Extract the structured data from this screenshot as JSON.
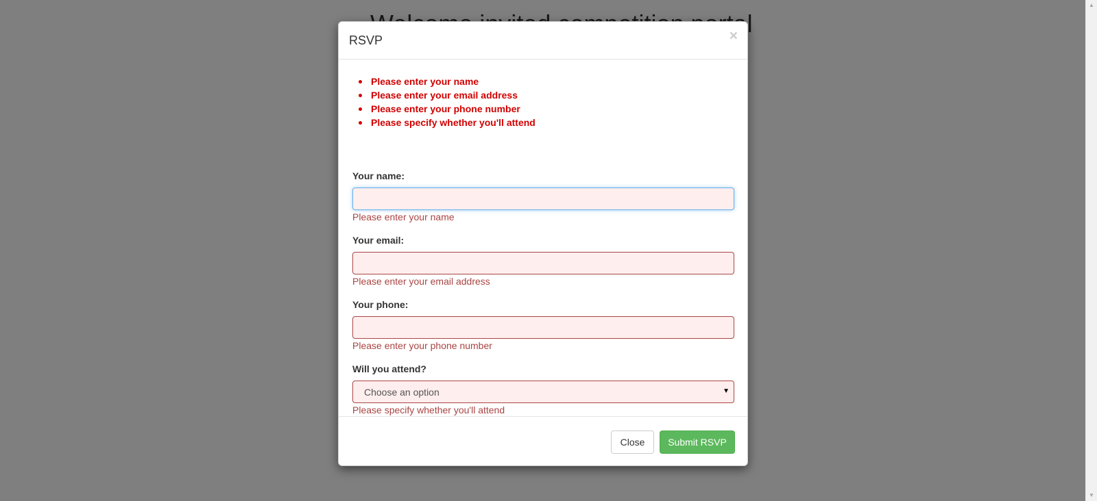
{
  "page": {
    "heading": "Welcome invited competition portal"
  },
  "modal": {
    "title": "RSVP",
    "close_symbol": "×",
    "validation_summary": [
      "Please enter your name",
      "Please enter your email address",
      "Please enter your phone number",
      "Please specify whether you'll attend"
    ],
    "fields": {
      "name": {
        "label": "Your name:",
        "value": "",
        "error": "Please enter your name"
      },
      "email": {
        "label": "Your email:",
        "value": "",
        "error": "Please enter your email address"
      },
      "phone": {
        "label": "Your phone:",
        "value": "",
        "error": "Please enter your phone number"
      },
      "attend": {
        "label": "Will you attend?",
        "selected": "Choose an option",
        "error": "Please specify whether you'll attend"
      }
    },
    "footer": {
      "close_label": "Close",
      "submit_label": "Submit RSVP"
    }
  },
  "colors": {
    "error_text": "#a94442",
    "summary_text": "#d10000",
    "input_error_bg": "#ffeeee",
    "submit_bg": "#5cb85c"
  },
  "icons": {
    "close": "close-icon",
    "dropdown": "chevron-down-icon"
  }
}
